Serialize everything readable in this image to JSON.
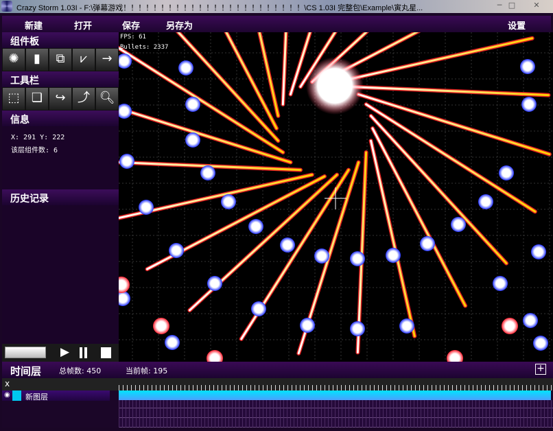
{
  "window": {
    "title": "Crazy Storm 1.03I - F:\\弹幕游戏！！！！！！！！！！！！！！！！！！！！！！！！\\CS 1.03I 完整包\\Example\\寅丸星...",
    "minimize": "─",
    "maximize": "□",
    "close": "✕"
  },
  "menu": {
    "new": "新建",
    "open": "打开",
    "save": "保存",
    "save_as": "另存为",
    "settings": "设置"
  },
  "panels": {
    "components": "组件板",
    "toolbar": "工具栏",
    "info": "信息",
    "history": "历史记录"
  },
  "info": {
    "coords": "X: 291  Y: 222",
    "layer_count": "该层组件数: 6"
  },
  "hud": {
    "fps": "FPS: 61",
    "bullets": "Bullets: 2337"
  },
  "timeline": {
    "title": "时间层",
    "total_frames": "总帧数: 450",
    "current_frame": "当前帧: 195",
    "add": "+",
    "close": "x"
  },
  "layers": [
    {
      "name": "新图层",
      "color": "#00c8f0"
    }
  ],
  "colors": {
    "accent": "#3a0a55",
    "layer_bar": "#00e4ff"
  }
}
